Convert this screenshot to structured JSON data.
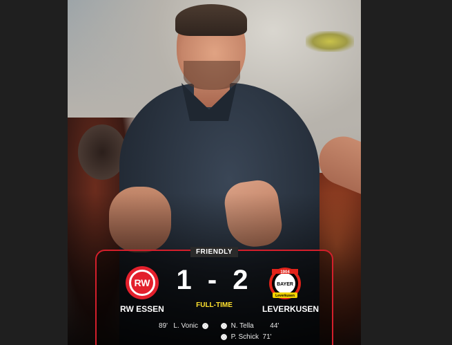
{
  "match": {
    "competition": "FRIENDLY",
    "status": "FULL-TIME",
    "score": "1 - 2",
    "home_team": "RW ESSEN",
    "away_team": "LEVERKUSEN",
    "home_scorers": [
      {
        "minute": "89'",
        "player": "L. Vonic"
      }
    ],
    "away_scorers": [
      {
        "player": "N. Tella",
        "minute": "44'"
      },
      {
        "player": "P. Schick",
        "minute": "71'"
      }
    ]
  },
  "crests": {
    "home_letter": "RW",
    "away_text": "BAYER",
    "away_year": "1904",
    "away_subtext": "Leverkusen"
  },
  "colors": {
    "accent_red": "#d41f2b",
    "status_yellow": "#ffe22e",
    "background": "#1f1f1f"
  }
}
